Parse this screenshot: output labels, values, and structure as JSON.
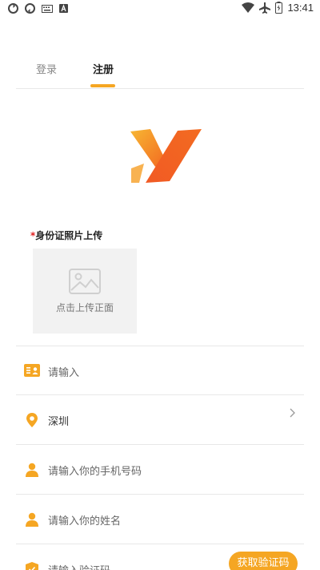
{
  "status_bar": {
    "time": "13:41"
  },
  "tabs": {
    "login": "登录",
    "register": "注册"
  },
  "id_section": {
    "required_mark": "*",
    "label": "身份证照片上传",
    "upload_text": "点击上传正面"
  },
  "form": {
    "id_placeholder": "请输入",
    "city_value": "深圳",
    "phone_placeholder": "请输入你的手机号码",
    "name_placeholder": "请输入你的姓名",
    "code_placeholder": "请输入验证码",
    "code_button": "获取验证码"
  },
  "colors": {
    "accent": "#f5a623",
    "required": "#e02020"
  }
}
